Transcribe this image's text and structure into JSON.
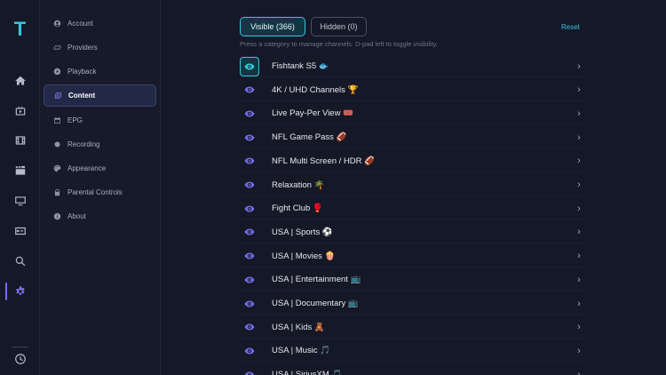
{
  "app": {
    "logo": "T"
  },
  "rail": {
    "items": [
      {
        "icon": "home-icon"
      },
      {
        "icon": "live-tv-icon"
      },
      {
        "icon": "movies-icon"
      },
      {
        "icon": "clapper-icon"
      },
      {
        "icon": "monitor-icon"
      },
      {
        "icon": "dvr-icon"
      },
      {
        "icon": "search-icon"
      },
      {
        "icon": "gear-icon",
        "active": true
      },
      {
        "icon": "clock-icon"
      }
    ],
    "accent": "#7b6cf2"
  },
  "sidebar": {
    "items": [
      {
        "label": "Account",
        "icon": "account-icon"
      },
      {
        "label": "Providers",
        "icon": "link-icon"
      },
      {
        "label": "Playback",
        "icon": "play-icon"
      },
      {
        "label": "Content",
        "icon": "content-icon",
        "active": true
      },
      {
        "label": "EPG",
        "icon": "calendar-icon"
      },
      {
        "label": "Recording",
        "icon": "record-icon"
      },
      {
        "label": "Appearance",
        "icon": "palette-icon"
      },
      {
        "label": "Parental Controls",
        "icon": "lock-icon"
      },
      {
        "label": "About",
        "icon": "info-icon"
      }
    ]
  },
  "main": {
    "tabs": {
      "visible": "Visible (366)",
      "hidden": "Hidden (0)"
    },
    "reset": "Reset",
    "hint": "Press a category to manage channels. D-pad left to toggle visibility.",
    "categories": [
      "Fishtank S5 🐟",
      "4K / UHD Channels 🏆",
      "Live Pay-Per View 🎟️",
      "NFL Game Pass 🏈",
      "NFL Multi Screen / HDR 🏈",
      "Relaxation 🌴",
      "Fight Club 🥊",
      "USA | Sports ⚽",
      "USA | Movies 🍿",
      "USA | Entertainment 📺",
      "USA | Documentary 📺",
      "USA | Kids 🧸",
      "USA | Music 🎵",
      "USA | SiriusXM 🎵"
    ],
    "accent": "#35c6dc",
    "eye_color": "#6f6be8"
  }
}
